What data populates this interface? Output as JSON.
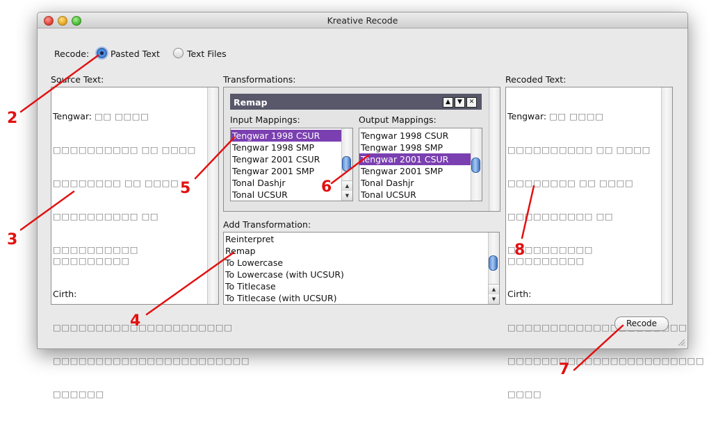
{
  "window": {
    "title": "Kreative Recode"
  },
  "recode": {
    "label": "Recode:",
    "options": [
      {
        "label": "Pasted Text",
        "selected": true
      },
      {
        "label": "Text Files",
        "selected": false
      }
    ]
  },
  "source": {
    "label": "Source Text:",
    "tengwar_label": "Tengwar:",
    "tengwar_lines": [
      "□□ □□□□",
      "□□□□□□□□□□ □□ □□□□",
      "□□□□□□□□ □□ □□□□",
      "□□□□□□□□□□ □□",
      "□□□□□□□□□□ □□□□□□□□□"
    ],
    "cirth_label": "Cirth:",
    "cirth_lines": [
      "□□□□□□□□□□□□□□□□□□□□□",
      "□□□□□□□□□□□□□□□□□□□□□□□",
      "□□□□□□"
    ]
  },
  "transformations": {
    "label": "Transformations:",
    "remap_title": "Remap",
    "up_icon": "▲",
    "down_icon": "▼",
    "close_icon": "✕",
    "input_label": "Input Mappings:",
    "output_label": "Output Mappings:",
    "input_items": [
      "Tengwar 1998 CSUR",
      "Tengwar 1998 SMP",
      "Tengwar 2001 CSUR",
      "Tengwar 2001 SMP",
      "Tonal Dashjr",
      "Tonal UCSUR"
    ],
    "input_selected": "Tengwar 1998 CSUR",
    "output_items": [
      "Tengwar 1998 CSUR",
      "Tengwar 1998 SMP",
      "Tengwar 2001 CSUR",
      "Tengwar 2001 SMP",
      "Tonal Dashjr",
      "Tonal UCSUR"
    ],
    "output_selected": "Tengwar 2001 CSUR"
  },
  "add_transformation": {
    "label": "Add Transformation:",
    "items": [
      "Reinterpret",
      "Remap",
      "To Lowercase",
      "To Lowercase (with UCSUR)",
      "To Titlecase",
      "To Titlecase (with UCSUR)"
    ]
  },
  "recoded": {
    "label": "Recoded Text:",
    "tengwar_label": "Tengwar:",
    "tengwar_lines": [
      "□□ □□□□",
      "□□□□□□□□□□ □□ □□□□",
      "□□□□□□□□ □□ □□□□",
      "□□□□□□□□□□ □□",
      "□□□□□□□□□□ □□□□□□□□□"
    ],
    "cirth_label": "Cirth:",
    "cirth_lines": [
      "□□□□□□□□□□□□□□□□□□□□□",
      "□□□□□□□□□□□□□□□□□□□□□□□",
      "□□□□"
    ]
  },
  "recode_button": {
    "label": "Recode"
  },
  "callouts": [
    "2",
    "3",
    "4",
    "5",
    "6",
    "7",
    "8"
  ],
  "colors": {
    "callout": "#e31010",
    "selection": "#7a3fb0",
    "remap_bar": "#58586a"
  }
}
